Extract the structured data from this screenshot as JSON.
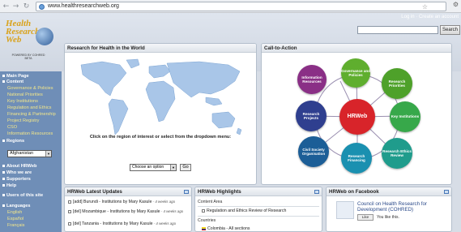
{
  "browser": {
    "url": "www.healthresearchweb.org"
  },
  "header": {
    "logo_line1": "Health",
    "logo_line2": "Research",
    "logo_line3": "Web",
    "logo_sub1": "POWERED BY COHRED",
    "logo_sub2": "BETA",
    "login_label": "Log in",
    "login_sep": " · ",
    "create_account_label": "Create an account",
    "search_button_label": "Search",
    "search_value": ""
  },
  "sidebar": {
    "main_page": "Main Page",
    "content": "Content",
    "content_items": [
      "Governance & Policies",
      "National Priorities",
      "Key Institutions",
      "Regulation and Ethics",
      "Financing & Partnership",
      "Project Registry",
      "CSO",
      "Information Resources"
    ],
    "regions": "Regions",
    "region_selected": "Afghanistan",
    "about": "About HRWeb",
    "who_we_are": "Who we are",
    "supporters": "Supporters",
    "help": "Help",
    "users": "Users of this site",
    "languages": "Languages",
    "language_items": [
      "English",
      "Español",
      "Français"
    ]
  },
  "map_panel": {
    "title": "Research for Health in the World",
    "caption": "Click on the region of interest or select from the dropdown menu:",
    "select_placeholder": "Choose an option",
    "go_label": "Go"
  },
  "cta_panel": {
    "title": "Call-to-Action",
    "center": "HRWeb",
    "nodes": [
      {
        "label": "Governance and Policies",
        "color": "#5fae2e"
      },
      {
        "label": "Research Priorities",
        "color": "#4ea12a"
      },
      {
        "label": "Key Institutions",
        "color": "#37a84a"
      },
      {
        "label": "Research Ethics Review",
        "color": "#1f9c8c"
      },
      {
        "label": "Research Financing",
        "color": "#1a90b0"
      },
      {
        "label": "Civil Society Organisation",
        "color": "#1c5e97"
      },
      {
        "label": "Research Projects",
        "color": "#2f3f8f"
      },
      {
        "label": "Information Resources",
        "color": "#8a2f86"
      }
    ],
    "center_color": "#d8242a"
  },
  "updates_panel": {
    "title": "HRWeb Latest Updates",
    "rows": [
      {
        "text": "[add] Burundi - Institutions by Mary Kasule",
        "meta": " - 4 weeks ago"
      },
      {
        "text": "[del] Mozambique - Institutions by Mary Kasule",
        "meta": " - 4 weeks ago"
      },
      {
        "text": "[del] Tanzania - Institutions by Mary Kasule",
        "meta": " - 4 weeks ago"
      }
    ]
  },
  "highlights_panel": {
    "title": "HRWeb Highlights",
    "content_area_label": "Content Area",
    "content_area_item": "Regulation and Ethics Review of Research",
    "countries_label": "Countries",
    "country_item": "Colombia - All sections"
  },
  "facebook_panel": {
    "title": "HRWeb on Facebook",
    "page_name": "Council on Health Research for Development (COHRED)",
    "like_label": "Like",
    "like_text": "You like this."
  }
}
